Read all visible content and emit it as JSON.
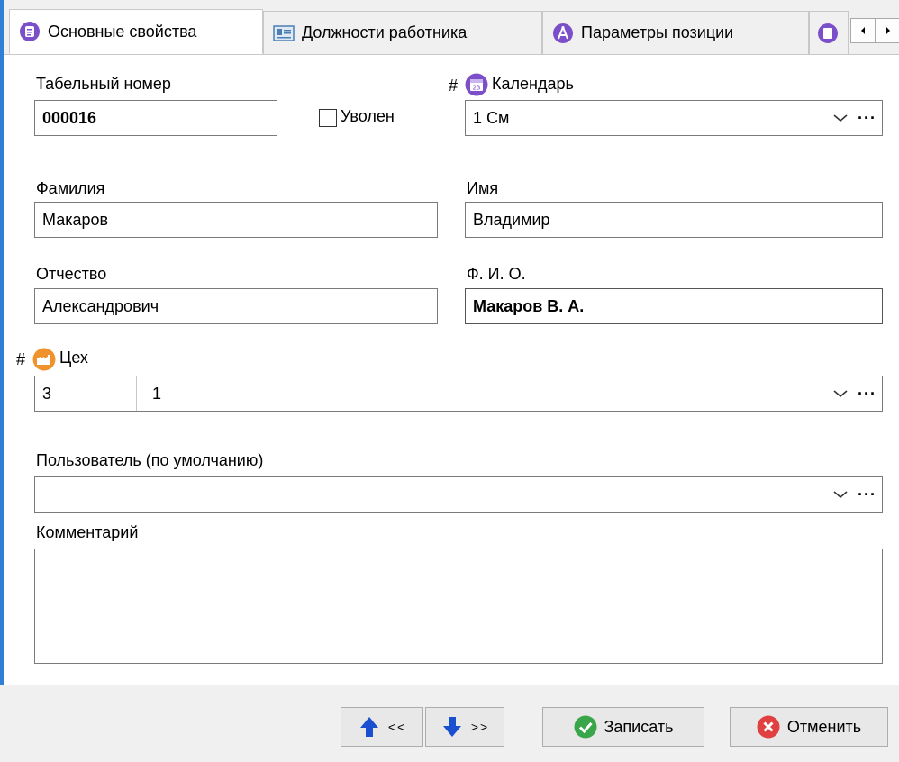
{
  "tabs": [
    {
      "label": "Основные свойства",
      "icon": "list-icon",
      "color": "#7b4fc9"
    },
    {
      "label": "Должности работника",
      "icon": "id-card-icon",
      "color": "#4a7fb5"
    },
    {
      "label": "Параметры позиции",
      "icon": "compass-icon",
      "color": "#7b4fc9"
    }
  ],
  "form": {
    "tab_number_label": "Табельный номер",
    "tab_number_value": "000016",
    "fired_label": "Уволен",
    "fired_checked": false,
    "calendar_marker": "#",
    "calendar_label": "Календарь",
    "calendar_value": "1 См",
    "surname_label": "Фамилия",
    "surname_value": "Макаров",
    "name_label": "Имя",
    "name_value": "Владимир",
    "patronymic_label": "Отчество",
    "patronymic_value": "Александрович",
    "fio_label": "Ф. И. О.",
    "fio_value": "Макаров В. А.",
    "workshop_marker": "#",
    "workshop_label": "Цех",
    "workshop_code": "3",
    "workshop_name": "1",
    "user_label": "Пользователь (по умолчанию)",
    "user_value": "",
    "comment_label": "Комментарий",
    "comment_value": "",
    "dropdown_more": "···"
  },
  "footer": {
    "prev_label": "<<",
    "next_label": ">>",
    "save_label": "Записать",
    "cancel_label": "Отменить"
  },
  "colors": {
    "accent_purple": "#7b4fc9",
    "accent_orange": "#f0922b",
    "save_green": "#3aa64a",
    "cancel_red": "#e04040",
    "nav_blue": "#1a4fd0"
  }
}
